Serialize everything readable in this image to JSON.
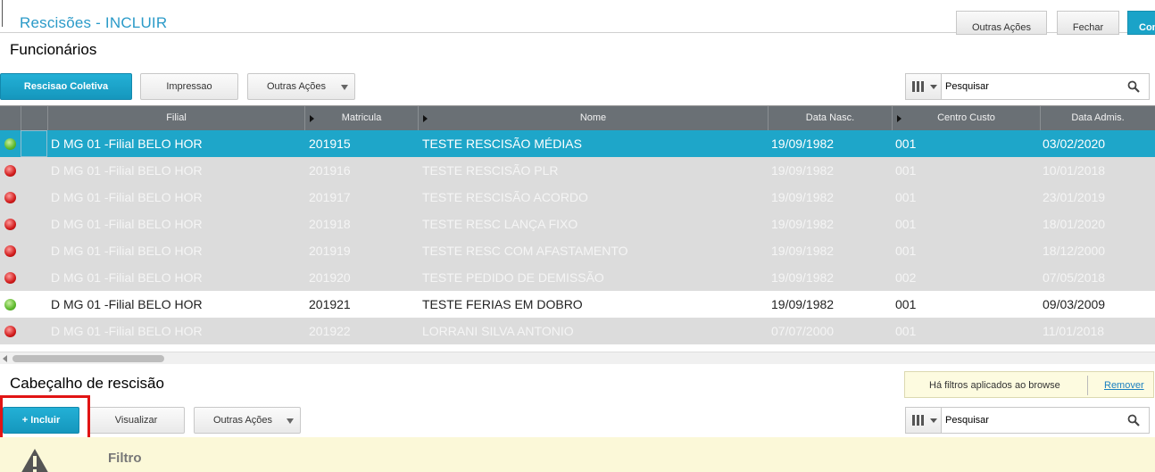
{
  "header": {
    "title": "Rescisões - INCLUIR",
    "outras_acoes": "Outras Ações",
    "fechar": "Fechar",
    "confirm": "Con"
  },
  "funcionarios": {
    "title": "Funcionários",
    "buttons": {
      "rescisao_coletiva": "Rescisao Coletiva",
      "impressao": "Impressao",
      "outras_acoes": "Outras Ações"
    },
    "search_placeholder": "Pesquisar",
    "columns": [
      "Filial",
      "Matricula",
      "Nome",
      "Data Nasc.",
      "Centro Custo",
      "Data Admis."
    ],
    "rows": [
      {
        "status": "green",
        "filial": "D MG 01 -Filial BELO HOR",
        "matricula": "201915",
        "nome": "TESTE RESCISÃO MÉDIAS",
        "nasc": "19/09/1982",
        "cc": "001",
        "admis": "03/02/2020",
        "style": "selected"
      },
      {
        "status": "red",
        "filial": "D MG 01 -Filial BELO HOR",
        "matricula": "201916",
        "nome": "TESTE RESCISÃO PLR",
        "nasc": "19/09/1982",
        "cc": "001",
        "admis": "10/01/2018",
        "style": "grey"
      },
      {
        "status": "red",
        "filial": "D MG 01 -Filial BELO HOR",
        "matricula": "201917",
        "nome": "TESTE RESCISÃO ACORDO",
        "nasc": "19/09/1982",
        "cc": "001",
        "admis": "23/01/2019",
        "style": "grey"
      },
      {
        "status": "red",
        "filial": "D MG 01 -Filial BELO HOR",
        "matricula": "201918",
        "nome": "TESTE RESC LANÇA FIXO",
        "nasc": "19/09/1982",
        "cc": "001",
        "admis": "18/01/2020",
        "style": "grey"
      },
      {
        "status": "red",
        "filial": "D MG 01 -Filial BELO HOR",
        "matricula": "201919",
        "nome": "TESTE  RESC COM AFASTAMENTO",
        "nasc": "19/09/1982",
        "cc": "001",
        "admis": "18/12/2000",
        "style": "grey"
      },
      {
        "status": "red",
        "filial": "D MG 01 -Filial BELO HOR",
        "matricula": "201920",
        "nome": "TESTE PEDIDO DE DEMISSÃO",
        "nasc": "19/09/1982",
        "cc": "002",
        "admis": "07/05/2018",
        "style": "grey"
      },
      {
        "status": "green",
        "filial": "D MG 01 -Filial BELO HOR",
        "matricula": "201921",
        "nome": "TESTE FERIAS EM DOBRO",
        "nasc": "19/09/1982",
        "cc": "001",
        "admis": "09/03/2009",
        "style": "white"
      },
      {
        "status": "red",
        "filial": "D MG 01 -Filial BELO HOR",
        "matricula": "201922",
        "nome": "LORRANI SILVA ANTONIO",
        "nasc": "07/07/2000",
        "cc": "001",
        "admis": "11/01/2018",
        "style": "grey"
      }
    ]
  },
  "cabecalho": {
    "title": "Cabeçalho de rescisão",
    "filter_note": "Há filtros aplicados ao browse",
    "remover": "Remover",
    "buttons": {
      "incluir": "+ Incluir",
      "visualizar": "Visualizar",
      "outras_acoes": "Outras Ações"
    },
    "search_placeholder": "Pesquisar",
    "filtro_label": "Filtro"
  }
}
